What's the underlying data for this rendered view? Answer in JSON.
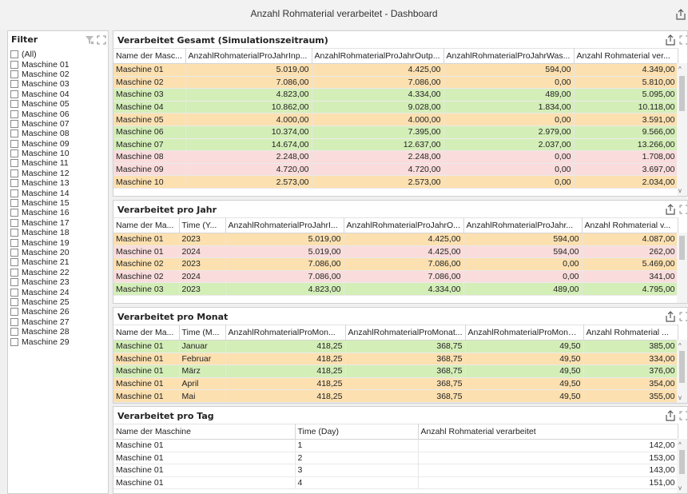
{
  "app": {
    "title": "Anzahl Rohmaterial verarbeitet - Dashboard"
  },
  "filter": {
    "caption": "Filter",
    "items": [
      "(All)",
      "Maschine 01",
      "Maschine 02",
      "Maschine 03",
      "Maschine 04",
      "Maschine 05",
      "Maschine 06",
      "Maschine 07",
      "Maschine 08",
      "Maschine 09",
      "Maschine 10",
      "Maschine 11",
      "Maschine 12",
      "Maschine 13",
      "Maschine 14",
      "Maschine 15",
      "Maschine 16",
      "Maschine 17",
      "Maschine 18",
      "Maschine 19",
      "Maschine 20",
      "Maschine 21",
      "Maschine 22",
      "Maschine 23",
      "Maschine 24",
      "Maschine 25",
      "Maschine 26",
      "Maschine 27",
      "Maschine 28",
      "Maschine 29"
    ]
  },
  "panels": {
    "gesamt": {
      "caption": "Verarbeitet Gesamt (Simulationszeitraum)",
      "columns": [
        "Name der Masc...",
        "AnzahlRohmaterialProJahrInp...",
        "AnzahlRohmaterialProJahrOutp...",
        "AnzahlRohmaterialProJahrWas...",
        "Anzahl Rohmaterial ver..."
      ],
      "rows": [
        {
          "c": "orange",
          "v": [
            "Maschine 01",
            "5.019,00",
            "4.425,00",
            "594,00",
            "4.349,00"
          ]
        },
        {
          "c": "orange",
          "v": [
            "Maschine 02",
            "7.086,00",
            "7.086,00",
            "0,00",
            "5.810,00"
          ]
        },
        {
          "c": "green",
          "v": [
            "Maschine 03",
            "4.823,00",
            "4.334,00",
            "489,00",
            "5.095,00"
          ]
        },
        {
          "c": "green",
          "v": [
            "Maschine 04",
            "10.862,00",
            "9.028,00",
            "1.834,00",
            "10.118,00"
          ]
        },
        {
          "c": "orange",
          "v": [
            "Maschine 05",
            "4.000,00",
            "4.000,00",
            "0,00",
            "3.591,00"
          ]
        },
        {
          "c": "green",
          "v": [
            "Maschine 06",
            "10.374,00",
            "7.395,00",
            "2.979,00",
            "9.566,00"
          ]
        },
        {
          "c": "green",
          "v": [
            "Maschine 07",
            "14.674,00",
            "12.637,00",
            "2.037,00",
            "13.266,00"
          ]
        },
        {
          "c": "pink",
          "v": [
            "Maschine 08",
            "2.248,00",
            "2.248,00",
            "0,00",
            "1.708,00"
          ]
        },
        {
          "c": "pink",
          "v": [
            "Maschine 09",
            "4.720,00",
            "4.720,00",
            "0,00",
            "3.697,00"
          ]
        },
        {
          "c": "orange",
          "v": [
            "Maschine 10",
            "2.573,00",
            "2.573,00",
            "0,00",
            "2.034,00"
          ]
        }
      ]
    },
    "jahr": {
      "caption": "Verarbeitet pro Jahr",
      "columns": [
        "Name der Ma...",
        "Time (Y...",
        "AnzahlRohmaterialProJahrI...",
        "AnzahlRohmaterialProJahrO...",
        "AnzahlRohmaterialProJahr...",
        "Anzahl Rohmaterial v..."
      ],
      "rows": [
        {
          "c": "orange",
          "v": [
            "Maschine 01",
            "2023",
            "5.019,00",
            "4.425,00",
            "594,00",
            "4.087,00"
          ]
        },
        {
          "c": "pink",
          "v": [
            "Maschine 01",
            "2024",
            "5.019,00",
            "4.425,00",
            "594,00",
            "262,00"
          ]
        },
        {
          "c": "orange",
          "v": [
            "Maschine 02",
            "2023",
            "7.086,00",
            "7.086,00",
            "0,00",
            "5.469,00"
          ]
        },
        {
          "c": "pink",
          "v": [
            "Maschine 02",
            "2024",
            "7.086,00",
            "7.086,00",
            "0,00",
            "341,00"
          ]
        },
        {
          "c": "green",
          "v": [
            "Maschine 03",
            "2023",
            "4.823,00",
            "4.334,00",
            "489,00",
            "4.795,00"
          ]
        }
      ]
    },
    "monat": {
      "caption": "Verarbeitet pro Monat",
      "columns": [
        "Name der Ma...",
        "Time (M...",
        "AnzahlRohmaterialProMon...",
        "AnzahlRohmaterialProMonat...",
        "AnzahlRohmaterialProMonat...",
        "Anzahl Rohmaterial ..."
      ],
      "rows": [
        {
          "c": "green",
          "v": [
            "Maschine 01",
            "Januar",
            "418,25",
            "368,75",
            "49,50",
            "385,00"
          ]
        },
        {
          "c": "orange",
          "v": [
            "Maschine 01",
            "Februar",
            "418,25",
            "368,75",
            "49,50",
            "334,00"
          ]
        },
        {
          "c": "green",
          "v": [
            "Maschine 01",
            "März",
            "418,25",
            "368,75",
            "49,50",
            "376,00"
          ]
        },
        {
          "c": "orange",
          "v": [
            "Maschine 01",
            "April",
            "418,25",
            "368,75",
            "49,50",
            "354,00"
          ]
        },
        {
          "c": "orange",
          "v": [
            "Maschine 01",
            "Mai",
            "418,25",
            "368,75",
            "49,50",
            "355,00"
          ]
        }
      ]
    },
    "tag": {
      "caption": "Verarbeitet pro Tag",
      "columns": [
        "Name der Maschine",
        "Time (Day)",
        "Anzahl Rohmaterial verarbeitet"
      ],
      "rows": [
        {
          "c": "white",
          "v": [
            "Maschine 01",
            "1",
            "142,00"
          ]
        },
        {
          "c": "white",
          "v": [
            "Maschine 01",
            "2",
            "153,00"
          ]
        },
        {
          "c": "white",
          "v": [
            "Maschine 01",
            "3",
            "143,00"
          ]
        },
        {
          "c": "white",
          "v": [
            "Maschine 01",
            "4",
            "151,00"
          ]
        }
      ]
    }
  }
}
